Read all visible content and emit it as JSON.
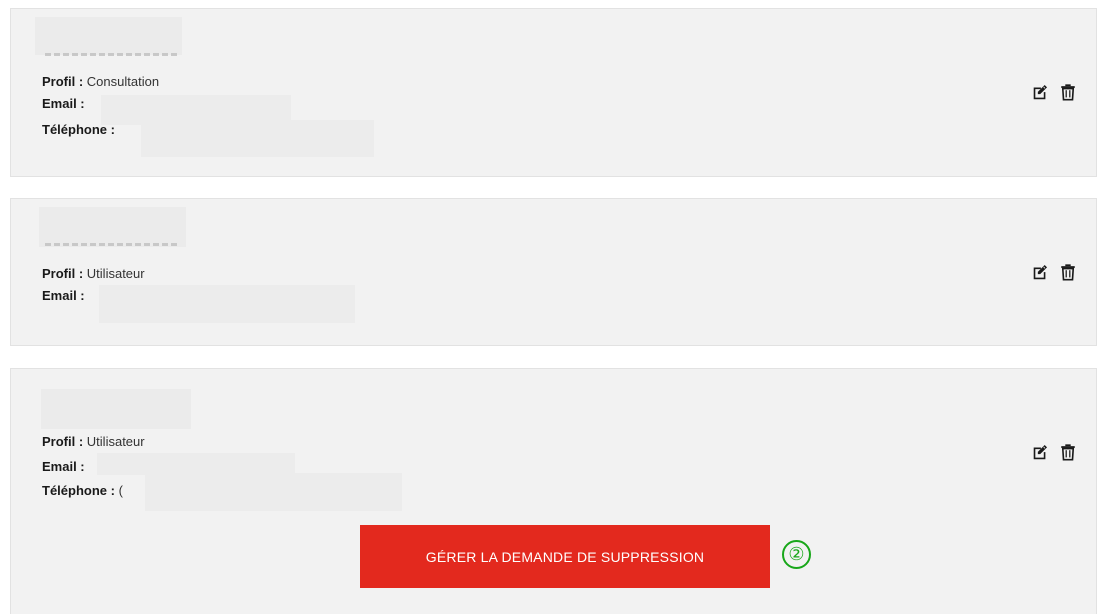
{
  "users": [
    {
      "profile_label": "Profil :",
      "profile_value": "Consultation",
      "email_label": "Email :",
      "phone_label": "Téléphone :"
    },
    {
      "profile_label": "Profil :",
      "profile_value": "Utilisateur",
      "email_label": "Email :"
    },
    {
      "profile_label": "Profil :",
      "profile_value": "Utilisateur",
      "email_label": "Email :",
      "phone_label": "Téléphone :",
      "phone_partial": "("
    }
  ],
  "actions": {
    "edit_icon": "edit-icon",
    "delete_icon": "trash-icon"
  },
  "deletion_request": {
    "button_label": "GÉRER LA DEMANDE DE SUPPRESSION",
    "step_marker": "②"
  },
  "colors": {
    "card_background": "#f2f2f2",
    "primary_button": "#e3291e",
    "step_marker": "#19a71a"
  }
}
